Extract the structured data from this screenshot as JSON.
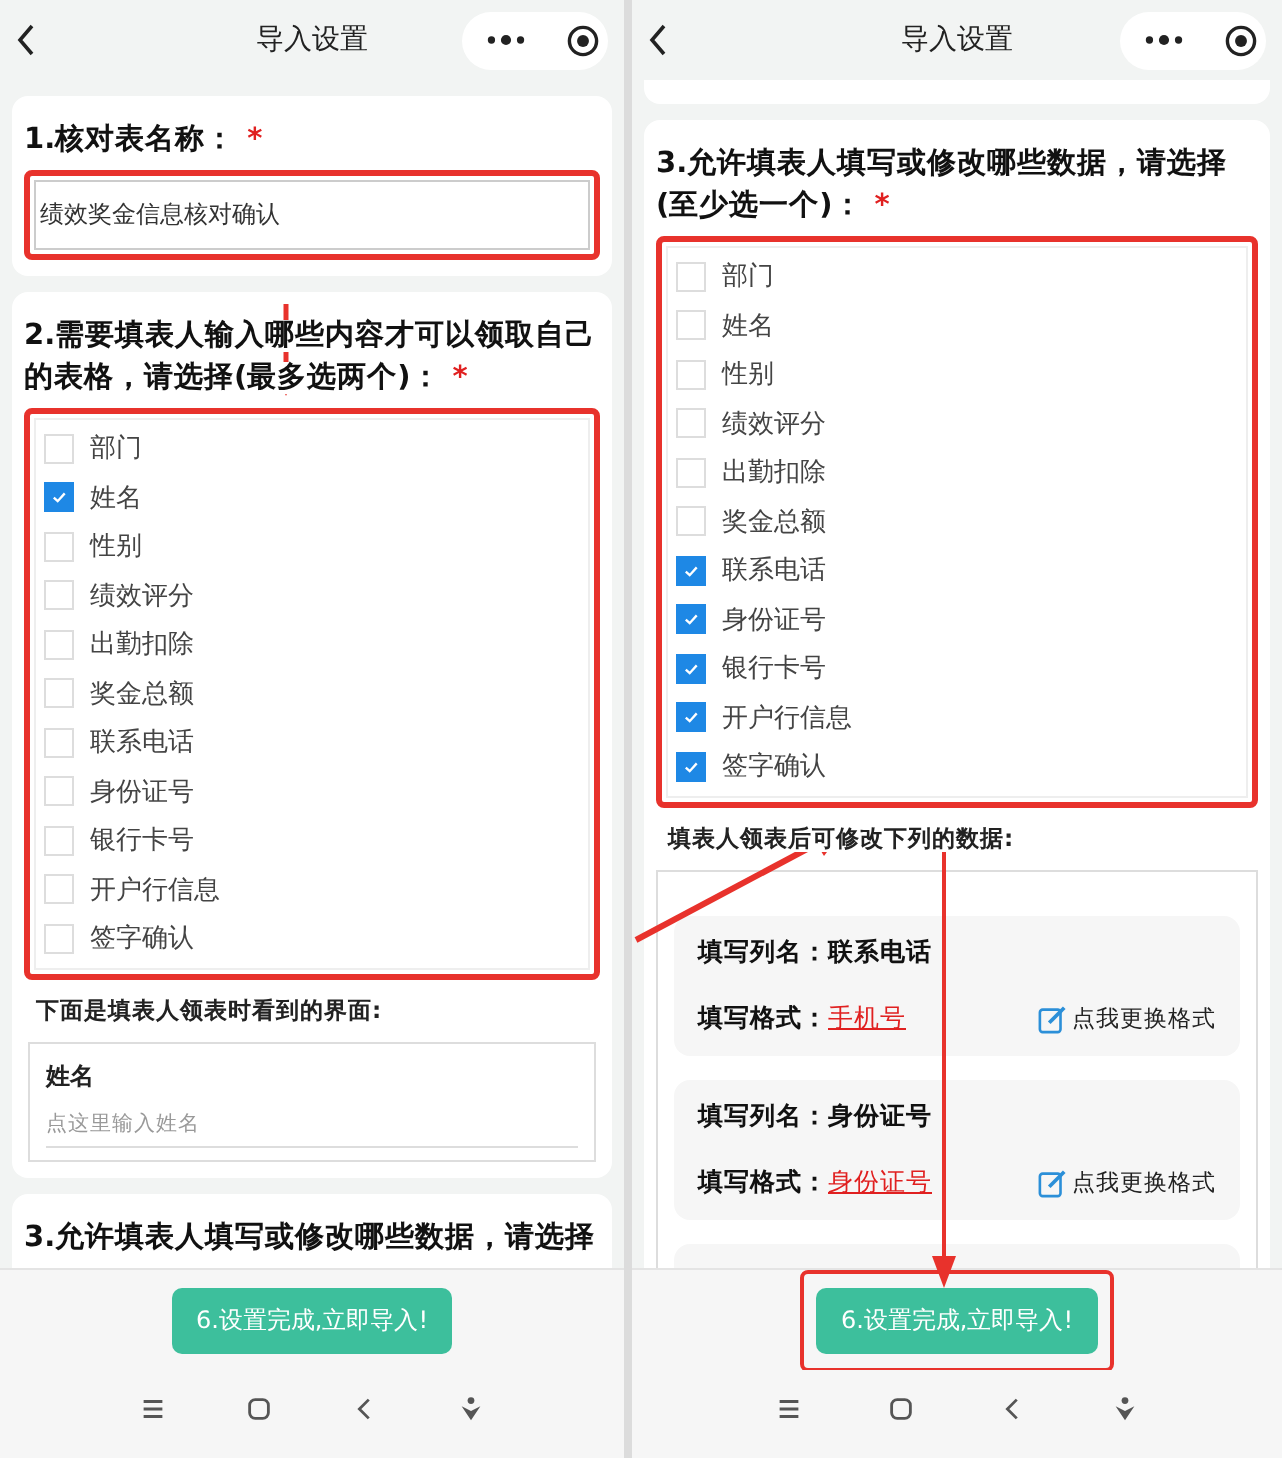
{
  "phones": [
    {
      "title": "导入设置",
      "sections": [
        {
          "kind": "name_field",
          "heading": "1.核对表名称：",
          "required_mark": "*",
          "value": "绩效奖金信息核对确认",
          "highlighted": true
        },
        {
          "kind": "checklist",
          "heading": "2.需要填表人输入哪些内容才可以领取自己的表格，请选择(最多选两个)：",
          "required_mark": "*",
          "highlighted": true,
          "options": [
            {
              "label": "部门",
              "checked": false
            },
            {
              "label": "姓名",
              "checked": true
            },
            {
              "label": "性别",
              "checked": false
            },
            {
              "label": "绩效评分",
              "checked": false
            },
            {
              "label": "出勤扣除",
              "checked": false
            },
            {
              "label": "奖金总额",
              "checked": false
            },
            {
              "label": "联系电话",
              "checked": false
            },
            {
              "label": "身份证号",
              "checked": false
            },
            {
              "label": "银行卡号",
              "checked": false
            },
            {
              "label": "开户行信息",
              "checked": false
            },
            {
              "label": "签字确认",
              "checked": false
            }
          ],
          "note": "下面是填表人领表时看到的界面:",
          "preview": {
            "label": "姓名",
            "placeholder": "点这里输入姓名"
          }
        },
        {
          "kind": "checklist",
          "heading": "3.允许填表人填写或修改哪些数据，请选择"
        }
      ],
      "button": {
        "label": "6.设置完成,立即导入!",
        "highlighted": false
      }
    },
    {
      "title": "导入设置",
      "sections": [
        {
          "kind": "checklist",
          "heading": "3.允许填表人填写或修改哪些数据，请选择(至少选一个)：",
          "required_mark": "*",
          "highlighted": true,
          "options": [
            {
              "label": "部门",
              "checked": false
            },
            {
              "label": "姓名",
              "checked": false
            },
            {
              "label": "性别",
              "checked": false
            },
            {
              "label": "绩效评分",
              "checked": false
            },
            {
              "label": "出勤扣除",
              "checked": false
            },
            {
              "label": "奖金总额",
              "checked": false
            },
            {
              "label": "联系电话",
              "checked": true
            },
            {
              "label": "身份证号",
              "checked": true
            },
            {
              "label": "银行卡号",
              "checked": true
            },
            {
              "label": "开户行信息",
              "checked": true
            },
            {
              "label": "签字确认",
              "checked": true
            }
          ],
          "note": "填表人领表后可修改下列的数据:",
          "editable": [
            {
              "column_label": "填写列名：",
              "column": "联系电话",
              "format_label": "填写格式：",
              "format": "手机号",
              "change": "点我更换格式"
            },
            {
              "column_label": "填写列名：",
              "column": "身份证号",
              "format_label": "填写格式：",
              "format": "身份证号",
              "change": "点我更换格式"
            }
          ]
        }
      ],
      "button": {
        "label": "6.设置完成,立即导入!",
        "highlighted": true
      }
    }
  ]
}
